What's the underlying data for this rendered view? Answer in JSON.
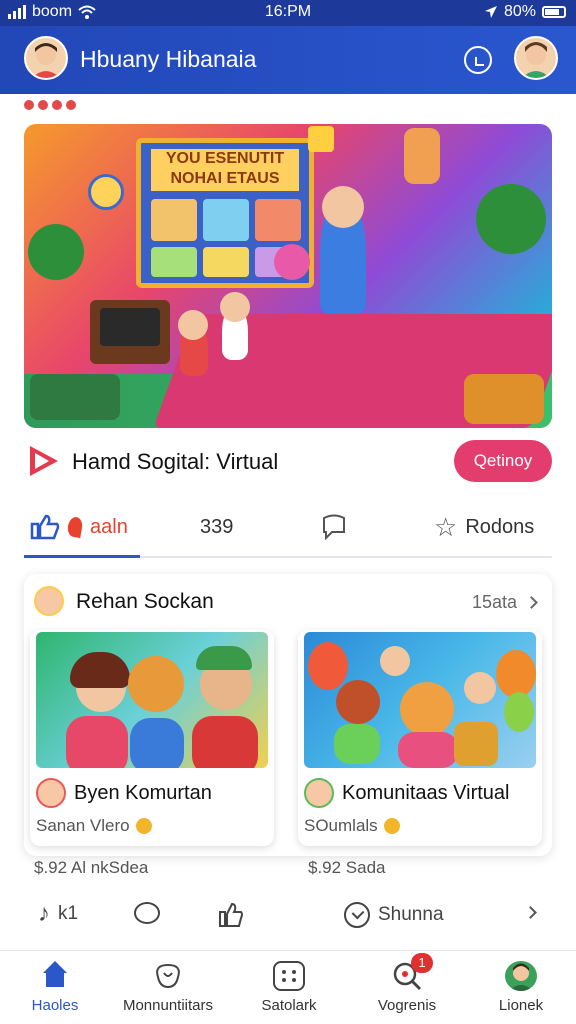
{
  "status_bar": {
    "carrier": "boom",
    "time": "16:PM",
    "battery": "80%"
  },
  "header": {
    "title": "Hbuany Hibanaia"
  },
  "hero": {
    "board_title": "YOU ESENUTIT NOHAI ETAUS"
  },
  "video": {
    "title": "Hamd Sogital: Virtual",
    "cta_label": "Qetinoy"
  },
  "actions": {
    "like_label": "aaln",
    "count": "339",
    "rate_label": "Rodons"
  },
  "community": {
    "title": "Rehan Sockan",
    "meta": "15ata",
    "cards": [
      {
        "title": "Byen Komurtan",
        "subtitle": "Sanan Vlero"
      },
      {
        "title": "Komunitaas Virtual",
        "subtitle": "SOumlals"
      }
    ]
  },
  "footer": {
    "price_left": "$.92 Al nkSdea",
    "price_right": "$.92 Sada",
    "like_count": "k1",
    "share_label": "Shunna"
  },
  "bottom_nav": {
    "items": [
      {
        "label": "Haoles",
        "icon": "home-icon"
      },
      {
        "label": "Monnuntiitars",
        "icon": "communities-icon"
      },
      {
        "label": "Satolark",
        "icon": "grid-icon"
      },
      {
        "label": "Vogrenis",
        "icon": "search-icon",
        "badge": "1"
      },
      {
        "label": "Lionek",
        "icon": "profile-avatar"
      }
    ]
  },
  "colors": {
    "header_blue": "#2247b7",
    "accent_pink": "#e23d6d",
    "active_blue": "#2b57c9"
  }
}
